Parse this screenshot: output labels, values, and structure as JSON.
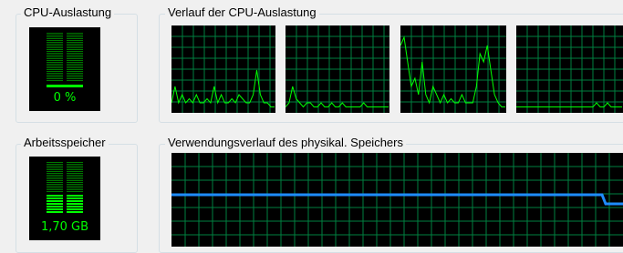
{
  "cpu_usage": {
    "title": "CPU-Auslastung",
    "value_label": "0 %",
    "value_percent": 0
  },
  "cpu_history": {
    "title": "Verlauf der CPU-Auslastung",
    "core_count_visible": 4
  },
  "memory": {
    "title": "Arbeitsspeicher",
    "value_label": "1,70 GB"
  },
  "memory_history": {
    "title": "Verwendungsverlauf des physikal. Speichers"
  },
  "colors": {
    "graph_grid": "#008040",
    "cpu_line": "#00ff00",
    "memory_line": "#1e8cff",
    "meter_text": "#00ff00"
  }
}
